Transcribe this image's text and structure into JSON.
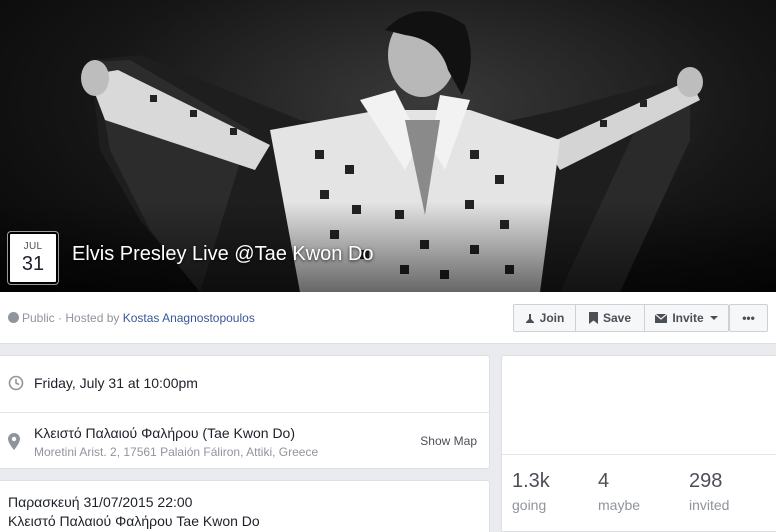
{
  "cover": {
    "date_month": "JUL",
    "date_day": "31",
    "title": "Elvis Presley Live @Tae Kwon Do"
  },
  "action_bar": {
    "privacy_text": "Public · Hosted by ",
    "host_name": "Kostas Anagnostopoulos",
    "join_label": "Join",
    "save_label": "Save",
    "invite_label": "Invite",
    "more_label": "•••"
  },
  "details": {
    "time": "Friday, July 31 at 10:00pm",
    "location_name": "Κλειστό Παλαιού Φαλήρου (Tae Kwon Do)",
    "location_address": "Moretini Arist. 2, 17561 Palaión Fáliron, Attiki, Greece",
    "show_map_label": "Show Map"
  },
  "stats": [
    {
      "count": "1.3k",
      "label": "going"
    },
    {
      "count": "4",
      "label": "maybe"
    },
    {
      "count": "298",
      "label": "invited"
    }
  ],
  "description": {
    "line1": "Παρασκευή 31/07/2015 22:00",
    "line2": "Κλειστό Παλαιού Φαλήρου Tae Kwon Do"
  },
  "colors": {
    "link": "#365899",
    "muted": "#90949c",
    "background": "#e9ebee"
  }
}
